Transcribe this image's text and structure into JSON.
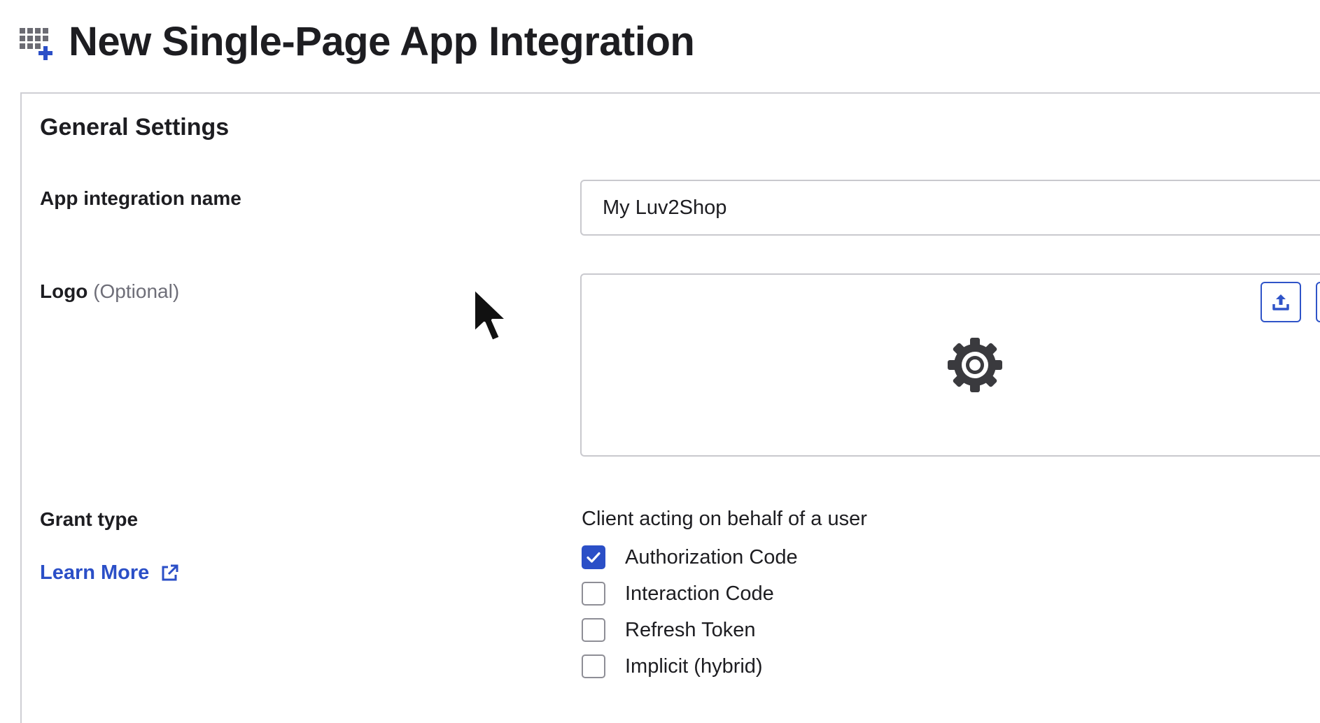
{
  "header": {
    "title": "New Single-Page App Integration",
    "icon": "apps-add-icon"
  },
  "general_settings": {
    "section_title": "General Settings",
    "app_name": {
      "label": "App integration name",
      "value": "My Luv2Shop"
    },
    "logo": {
      "label": "Logo",
      "optional_note": "(Optional)",
      "placeholder_icon": "gear-icon",
      "upload_icon": "upload-icon"
    },
    "grant_type": {
      "label": "Grant type",
      "learn_more": "Learn More",
      "learn_more_icon": "external-link-icon",
      "group_label": "Client acting on behalf of a user",
      "options": [
        {
          "label": "Authorization Code",
          "checked": true
        },
        {
          "label": "Interaction Code",
          "checked": false
        },
        {
          "label": "Refresh Token",
          "checked": false
        },
        {
          "label": "Implicit (hybrid)",
          "checked": false
        }
      ]
    }
  },
  "colors": {
    "accent": "#2b4fc7",
    "border": "#c9c9ce",
    "text": "#1d1d21",
    "muted": "#6e6e78"
  }
}
